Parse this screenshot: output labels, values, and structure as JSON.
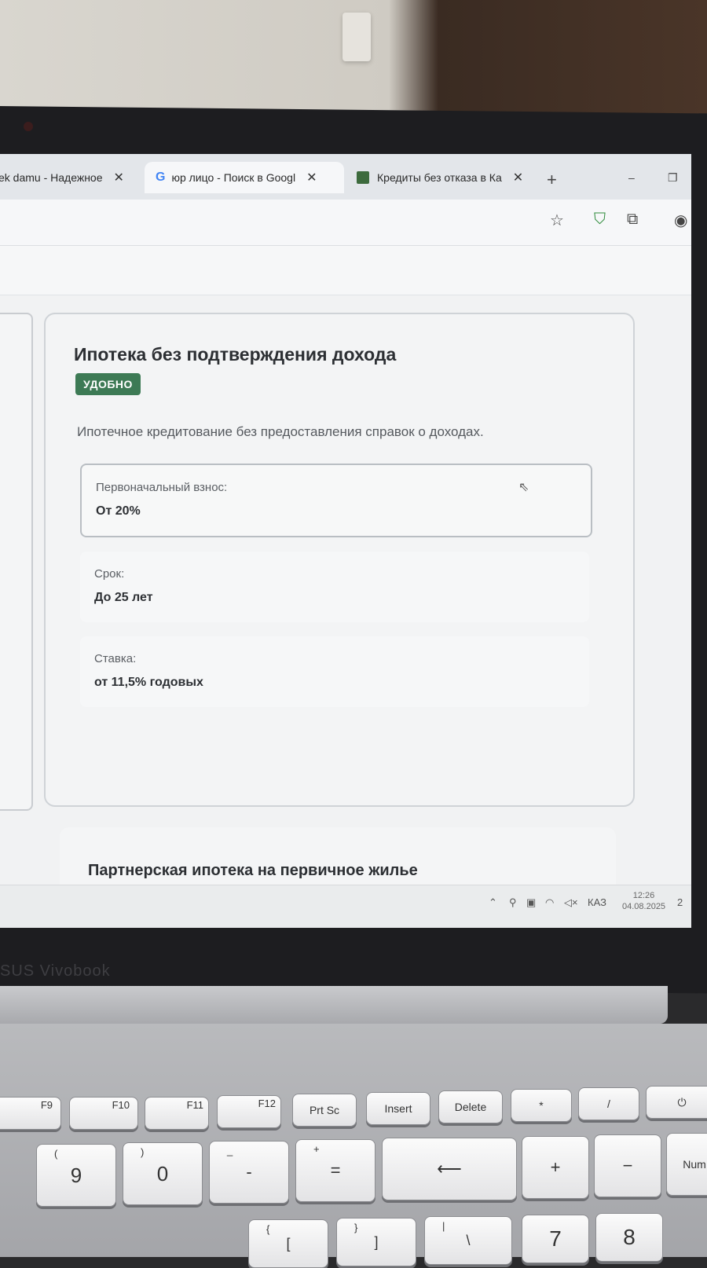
{
  "browser": {
    "tabs": [
      {
        "label": "ek damu - Надежное"
      },
      {
        "label": "юр лицо - Поиск в Googl"
      },
      {
        "label": "Кредиты без отказа в Ка"
      }
    ],
    "new_tab": "+",
    "win_min": "–",
    "win_restore": "❐"
  },
  "main_card": {
    "title": "Ипотека без подтверждения дохода",
    "badge": "УДОБНО",
    "description": "Ипотечное кредитование без предоставления справок о доходах.",
    "items": [
      {
        "label": "Первоначальный взнос:",
        "value": "От 20%"
      },
      {
        "label": "Срок:",
        "value": "До 25 лет"
      },
      {
        "label": "Ставка:",
        "value": "от 11,5% годовых"
      }
    ]
  },
  "next_card": {
    "title": "Партнерская ипотека на первичное жилье"
  },
  "taskbar": {
    "lang": "КАЗ",
    "time": "12:26",
    "date": "04.08.2025",
    "notifications": "2"
  },
  "laptop": {
    "brand": "SUS Vivobook"
  },
  "keyboard": {
    "fkeys": [
      "F9",
      "F10",
      "F11",
      "F12",
      "Prt Sc",
      "Insert",
      "Delete",
      "*",
      "/",
      "⏻"
    ],
    "row2": [
      "9",
      "0",
      "-",
      "=",
      "⟵",
      "+",
      "−",
      "Num"
    ],
    "row2_sub": [
      "(",
      ")",
      "_",
      "+"
    ],
    "row3": [
      "[",
      "]",
      "\\",
      "7",
      "8"
    ],
    "row3_sub": [
      "{",
      "}",
      "|"
    ]
  }
}
